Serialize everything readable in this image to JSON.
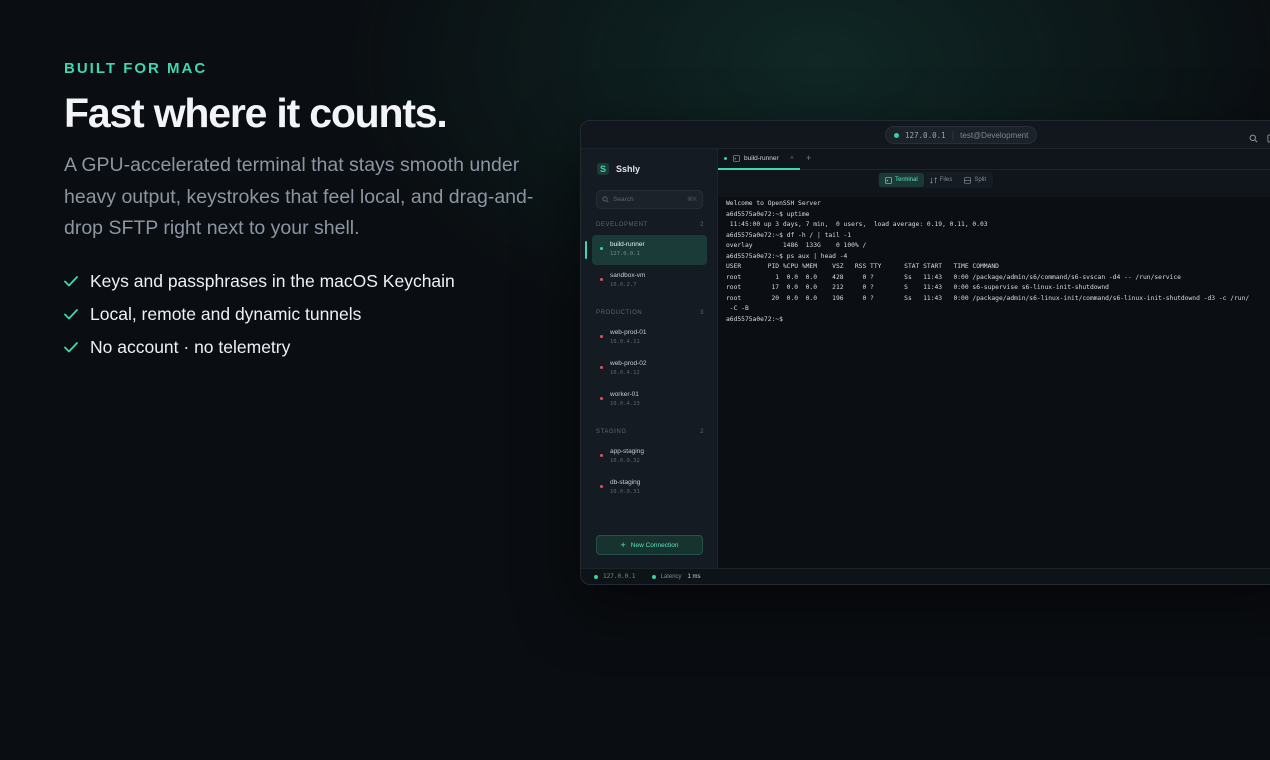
{
  "hero": {
    "eyebrow": "BUILT FOR MAC",
    "headline": "Fast where it counts.",
    "subtext": "A GPU-accelerated terminal that stays smooth under heavy output, keystrokes that feel local, and drag-and-drop SFTP right next to your shell.",
    "features": [
      "Keys and passphrases in the macOS Keychain",
      "Local, remote and dynamic tunnels",
      "No account · no telemetry"
    ]
  },
  "app": {
    "titlebar": {
      "address": "127.0.0.1",
      "profile": "test@Development"
    },
    "brand": "Sshly",
    "search": {
      "placeholder": "Search",
      "shortcut": "⌘K"
    },
    "groups": [
      {
        "label": "DEVELOPMENT",
        "count": "2",
        "hosts": [
          {
            "name": "build-runner",
            "ip": "127.0.0.1",
            "active": true
          },
          {
            "name": "sandbox-vm",
            "ip": "10.0.2.7",
            "active": false
          }
        ]
      },
      {
        "label": "PRODUCTION",
        "count": "3",
        "hosts": [
          {
            "name": "web-prod-01",
            "ip": "10.0.4.11",
            "active": false
          },
          {
            "name": "web-prod-02",
            "ip": "10.0.4.12",
            "active": false
          },
          {
            "name": "worker-01",
            "ip": "10.0.4.23",
            "active": false
          }
        ]
      },
      {
        "label": "STAGING",
        "count": "2",
        "hosts": [
          {
            "name": "app-staging",
            "ip": "10.0.9.32",
            "active": false
          },
          {
            "name": "db-staging",
            "ip": "10.0.9.31",
            "active": false
          }
        ]
      }
    ],
    "new_connection": "New Connection",
    "tab": {
      "label": "build-runner",
      "close": "×",
      "add": "+"
    },
    "views": [
      "Terminal",
      "Files",
      "Split"
    ],
    "active_view": "Terminal",
    "terminal_lines": [
      "Welcome to OpenSSH Server",
      "a6d5575a0e72:~$ uptime",
      " 11:45:00 up 3 days, 7 min,  0 users,  load average: 0.19, 0.11, 0.03",
      "a6d5575a0e72:~$ df -h / | tail -1",
      "overlay        1486  133G    0 100% /",
      "a6d5575a0e72:~$ ps aux | head -4",
      "USER       PID %CPU %MEM    VSZ   RSS TTY      STAT START   TIME COMMAND",
      "root         1  0.0  0.0    428     0 ?        Ss   11:43   0:00 /package/admin/s6/command/s6-svscan -d4 -- /run/service",
      "root        17  0.0  0.0    212     0 ?        S    11:43   0:00 s6-supervise s6-linux-init-shutdownd",
      "root        20  0.0  0.0    196     0 ?        Ss   11:43   0:00 /package/admin/s6-linux-init/command/s6-linux-init-shutdownd -d3 -c /run/",
      " -C -B",
      "a6d5575a0e72:~$"
    ],
    "status": {
      "ip": "127.0.0.1",
      "latency_label": "Latency",
      "latency_value": "1 ms"
    }
  },
  "colors": {
    "accent": "#3fd6b0",
    "connected": "#34d399",
    "disconnected": "#e05555",
    "background": "#0a0d11"
  },
  "icons": [
    "check-icon",
    "search-icon",
    "more-icon",
    "terminal-icon",
    "files-icon",
    "split-icon",
    "plus-icon",
    "close-icon"
  ]
}
